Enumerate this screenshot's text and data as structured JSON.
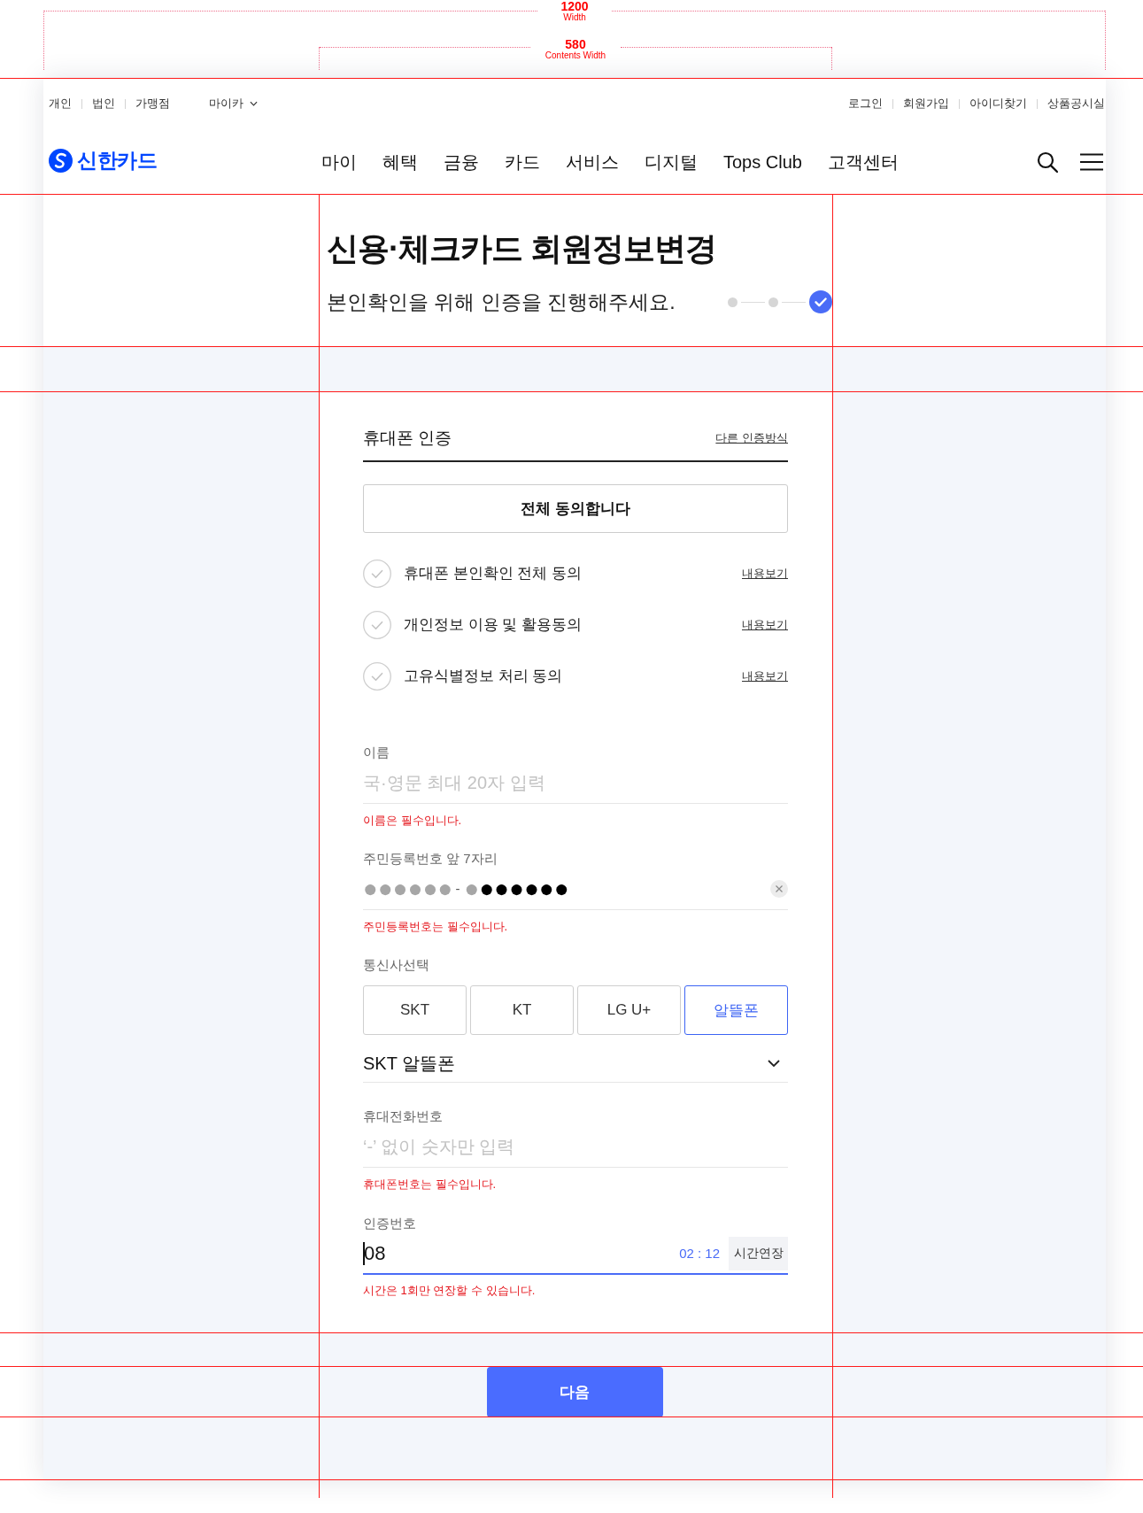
{
  "annotations": {
    "page_width": {
      "value": "1200",
      "label": "Width"
    },
    "content_width": {
      "value": "580",
      "label": "Contents Width"
    }
  },
  "header": {
    "segments": [
      "개인",
      "법인",
      "가맹점"
    ],
    "mycar": "마이카",
    "account_links": [
      "로그인",
      "회원가입",
      "아이디찾기",
      "상품공시실"
    ],
    "logo": "신한카드",
    "nav": [
      "마이",
      "혜택",
      "금융",
      "카드",
      "서비스",
      "디지털",
      "Tops Club",
      "고객센터"
    ]
  },
  "page": {
    "title": "신용·체크카드 회원정보변경",
    "subtitle": "본인확인을 위해 인증을 진행해주세요.",
    "steps": [
      {
        "current": false
      },
      {
        "current": false
      },
      {
        "current": true
      }
    ]
  },
  "auth": {
    "title": "휴대폰 인증",
    "other_method": "다른 인증방식",
    "agree_all": "전체 동의합니다",
    "consents": [
      {
        "label": "휴대폰 본인확인 전체 동의",
        "link": "내용보기",
        "checked": false
      },
      {
        "label": "개인정보 이용 및 활용동의",
        "link": "내용보기",
        "checked": false
      },
      {
        "label": "고유식별정보 처리 동의",
        "link": "내용보기",
        "checked": false
      }
    ]
  },
  "name_field": {
    "label": "이름",
    "placeholder": "국·영문 최대 20자 입력",
    "error": "이름은 필수입니다."
  },
  "rrn_field": {
    "label": "주민등록번호 앞 7자리",
    "front": "●●●●●●",
    "separator": "-",
    "gender_digit": "●",
    "masked": "●●●●●●",
    "entered": false,
    "error": "주민등록번호는 필수입니다."
  },
  "carrier": {
    "label": "통신사선택",
    "options": [
      {
        "label": "SKT",
        "selected": false
      },
      {
        "label": "KT",
        "selected": false
      },
      {
        "label": "LG U+",
        "selected": false
      },
      {
        "label": "알뜰폰",
        "selected": true
      }
    ],
    "plan": "SKT 알뜰폰"
  },
  "phone_field": {
    "label": "휴대전화번호",
    "placeholder": "‘-’ 없이 숫자만 입력",
    "error": "휴대폰번호는 필수입니다."
  },
  "code_field": {
    "label": "인증번호",
    "value": "08",
    "focused": true,
    "timer": "02 : 12",
    "extend": "시간연장",
    "error": "시간은 1회만 연장할 수 있습니다."
  },
  "next_button": "다음"
}
